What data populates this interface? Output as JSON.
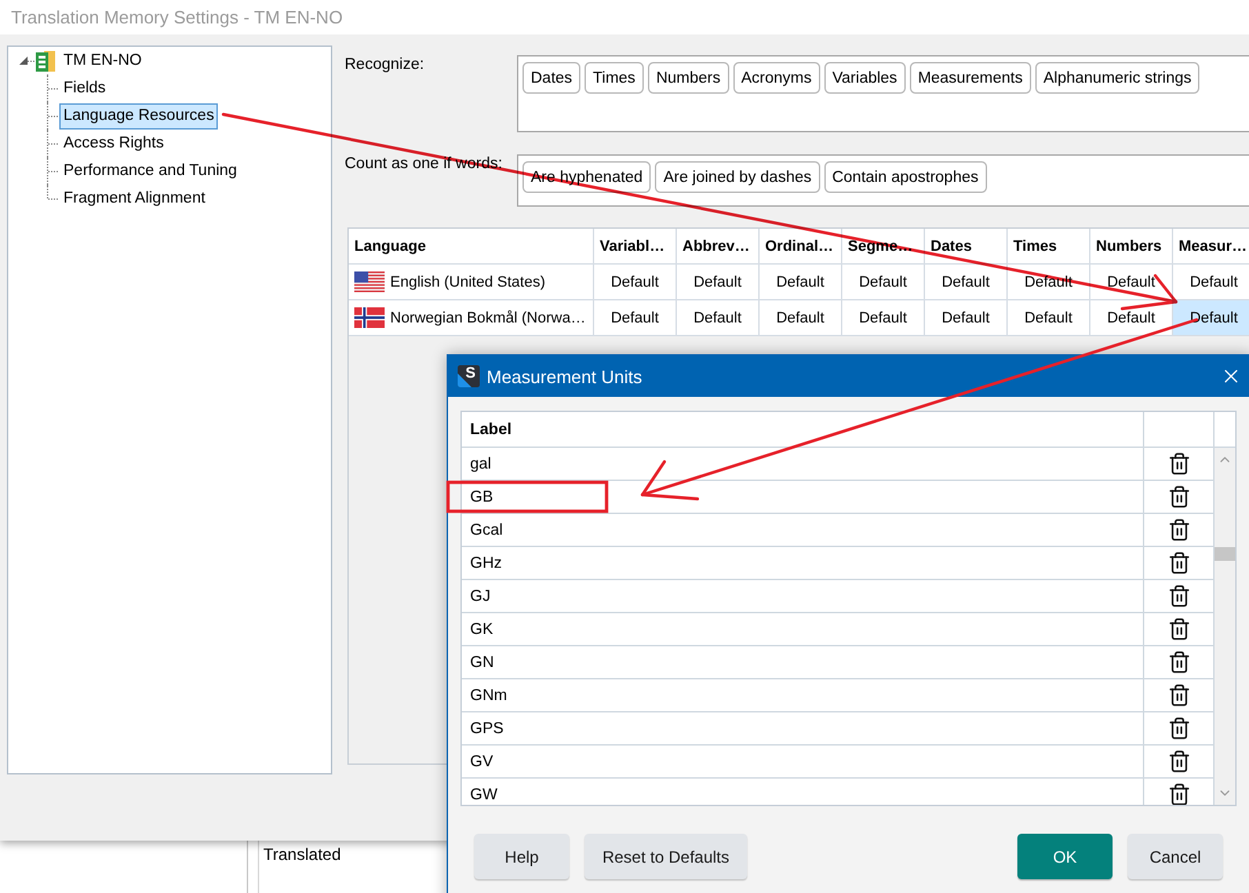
{
  "window": {
    "title": "Translation Memory Settings - TM EN-NO"
  },
  "tree": {
    "label": "TM EN-NO",
    "selected": false,
    "expanded": true,
    "children": [
      {
        "label": "Fields",
        "selected": false
      },
      {
        "label": "Language Resources",
        "selected": true
      },
      {
        "label": "Access Rights",
        "selected": false
      },
      {
        "label": "Performance and Tuning",
        "selected": false
      },
      {
        "label": "Fragment Alignment",
        "selected": false
      }
    ]
  },
  "recognize": {
    "label": "Recognize:",
    "tags": [
      "Dates",
      "Times",
      "Numbers",
      "Acronyms",
      "Variables",
      "Measurements",
      "Alphanumeric strings"
    ]
  },
  "count_as_one": {
    "label": "Count as one if words:",
    "tags": [
      "Are hyphenated",
      "Are joined by dashes",
      "Contain apostrophes"
    ]
  },
  "language_table": {
    "columns": [
      "Language",
      "Variabl…",
      "Abbrev…",
      "Ordinal…",
      "Segme…",
      "Dates",
      "Times",
      "Numbers",
      "Measur…"
    ],
    "rows": [
      {
        "kind": "us",
        "cells": [
          {
            "text": "English (United States)",
            "selected": false
          },
          {
            "text": "Default",
            "selected": false
          },
          {
            "text": "Default",
            "selected": false
          },
          {
            "text": "Default",
            "selected": false
          },
          {
            "text": "Default",
            "selected": false
          },
          {
            "text": "Default",
            "selected": false
          },
          {
            "text": "Default",
            "selected": false
          },
          {
            "text": "Default",
            "selected": false
          },
          {
            "text": "Default",
            "selected": false
          }
        ]
      },
      {
        "kind": "no",
        "cells": [
          {
            "text": "Norwegian Bokmål (Norwa…",
            "selected": false
          },
          {
            "text": "Default",
            "selected": false
          },
          {
            "text": "Default",
            "selected": false
          },
          {
            "text": "Default",
            "selected": false
          },
          {
            "text": "Default",
            "selected": false
          },
          {
            "text": "Default",
            "selected": false
          },
          {
            "text": "Default",
            "selected": false
          },
          {
            "text": "Default",
            "selected": false
          },
          {
            "text": "Default",
            "selected": true
          }
        ]
      }
    ]
  },
  "background_window": {
    "text": "Translated"
  },
  "dialog": {
    "title": "Measurement Units",
    "logo_text": "S",
    "list": {
      "header": "Label",
      "rows": [
        "gal",
        "GB",
        "Gcal",
        "GHz",
        "GJ",
        "GK",
        "GN",
        "GNm",
        "GPS",
        "GV",
        "GW"
      ]
    },
    "buttons_left": [
      {
        "label": "Help",
        "kind": "secondary"
      },
      {
        "label": "Reset to Defaults",
        "kind": "secondary"
      }
    ],
    "buttons_right": [
      {
        "label": "OK",
        "kind": "primary"
      },
      {
        "label": "Cancel",
        "kind": "secondary"
      }
    ]
  }
}
